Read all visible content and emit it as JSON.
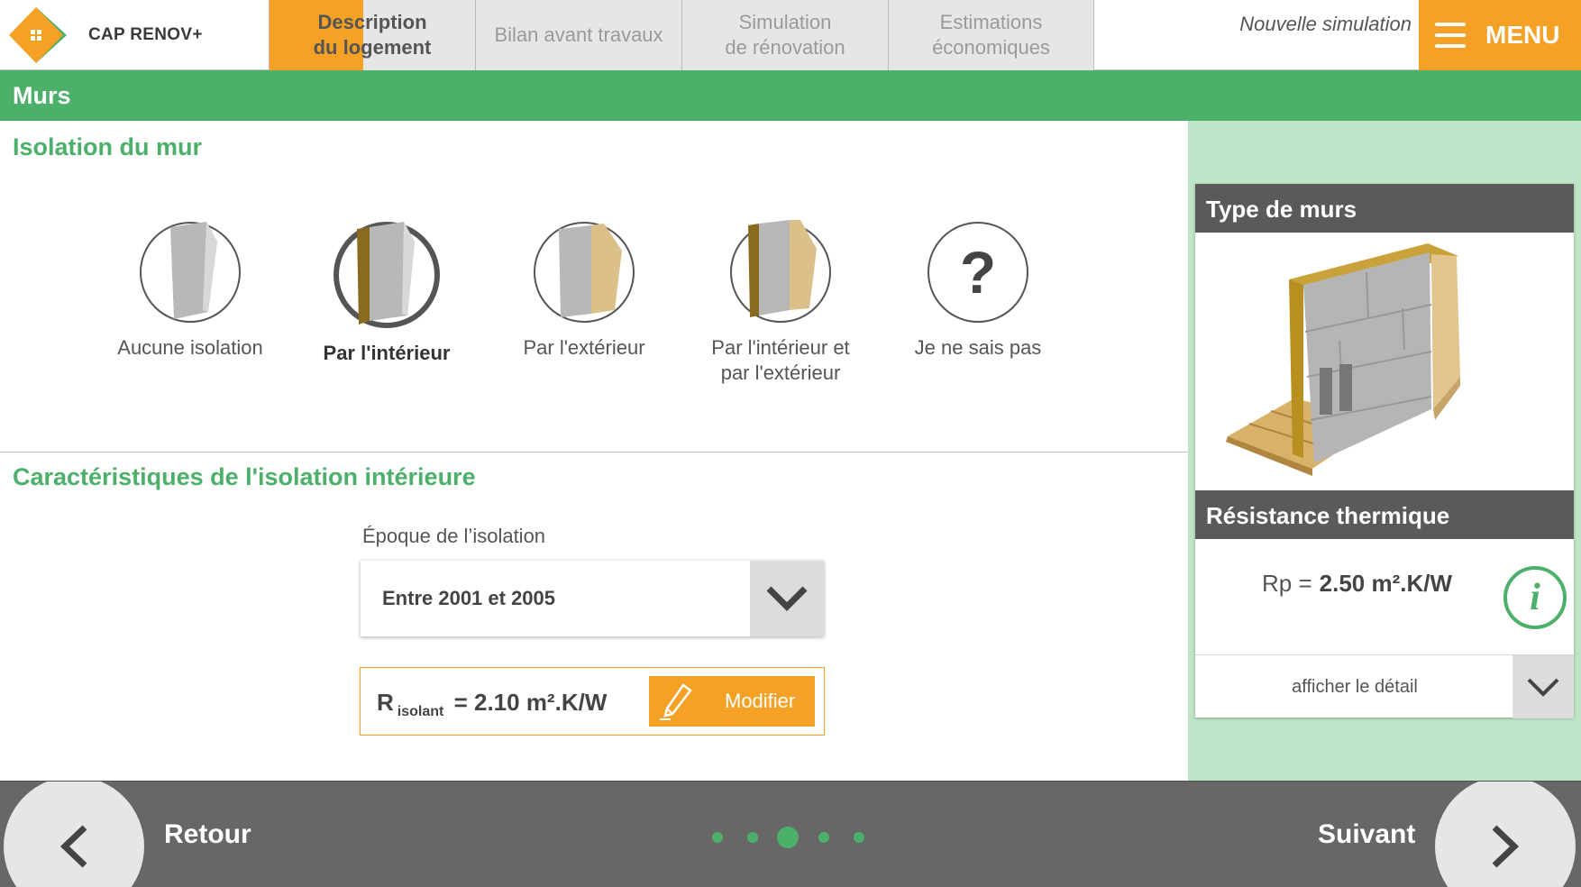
{
  "app": {
    "name": "CAP RENOV+",
    "accent_color": "#f4a125",
    "green_color": "#4caf6a"
  },
  "tabs": [
    {
      "label": "Description\ndu logement",
      "active": true
    },
    {
      "label": "Bilan avant travaux",
      "active": false
    },
    {
      "label": "Simulation\nde rénovation",
      "active": false
    },
    {
      "label": "Estimations\néconomiques",
      "active": false
    }
  ],
  "header": {
    "new_simulation": "Nouvelle simulation",
    "menu_label": "MENU",
    "menu_icon": "hamburger-icon"
  },
  "section": {
    "title": "Murs"
  },
  "isolation": {
    "title": "Isolation du mur",
    "options": [
      {
        "label": "Aucune isolation",
        "selected": false
      },
      {
        "label": "Par l'intérieur",
        "selected": true
      },
      {
        "label": "Par l'extérieur",
        "selected": false
      },
      {
        "label": "Par l'intérieur et\npar l'extérieur",
        "selected": false
      },
      {
        "label": "Je ne sais pas",
        "selected": false,
        "glyph": "?"
      }
    ]
  },
  "characteristics": {
    "title": "Caractéristiques de l'isolation intérieure",
    "epoque_label": "Époque de l’isolation",
    "epoque_value": "Entre 2001 et 2005",
    "r_main": "R",
    "r_sub": "isolant",
    "r_value": "= 2.10 m².K/W",
    "modify_label": "Modifier"
  },
  "sidebar": {
    "type_title": "Type de murs",
    "resistance_title": "Résistance thermique",
    "rp_label": "Rp =",
    "rp_value": "2.50 m².K/W",
    "info_glyph": "i",
    "detail_label": "afficher le détail"
  },
  "footer": {
    "back_label": "Retour",
    "next_label": "Suivant",
    "pages_total": 5,
    "current_page": 3
  }
}
